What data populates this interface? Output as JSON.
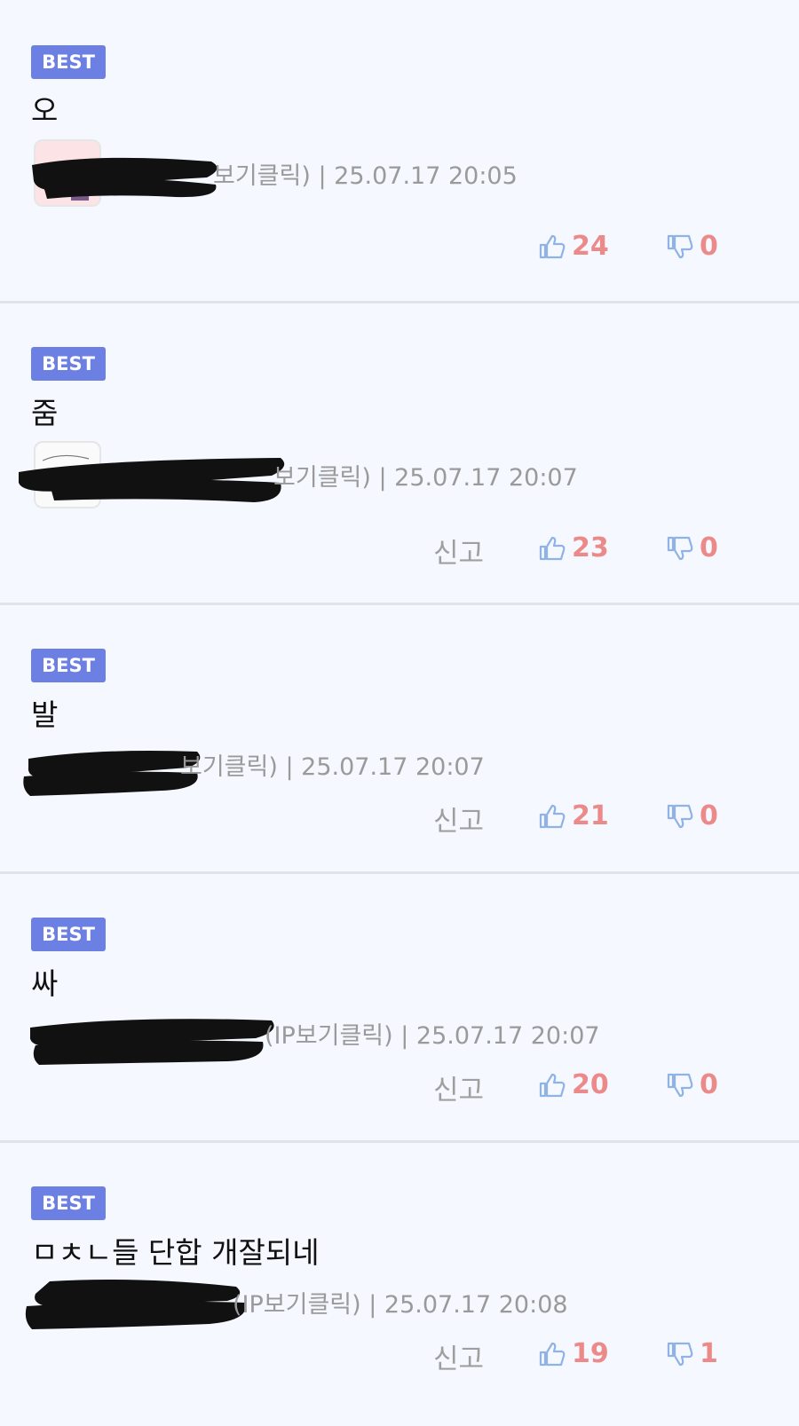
{
  "comments": [
    {
      "badge": "BEST",
      "text": "오",
      "meta_visible": "보기클릭) | 25.07.17 20:05",
      "report": "",
      "likes": "24",
      "dislikes": "0"
    },
    {
      "badge": "BEST",
      "text": "줌",
      "meta_visible": "보기클릭) | 25.07.17 20:07",
      "report": "신고",
      "likes": "23",
      "dislikes": "0"
    },
    {
      "badge": "BEST",
      "text": "발",
      "meta_visible": "보기클릭) | 25.07.17 20:07",
      "report": "신고",
      "likes": "21",
      "dislikes": "0"
    },
    {
      "badge": "BEST",
      "text": "싸",
      "meta_visible": "(IP보기클릭) | 25.07.17 20:07",
      "report": "신고",
      "likes": "20",
      "dislikes": "0"
    },
    {
      "badge": "BEST",
      "text": "ㅁㅊㄴ들 단합 개잘되네",
      "meta_visible": "(IP보기클릭) | 25.07.17 20:08",
      "report": "신고",
      "likes": "19",
      "dislikes": "1"
    }
  ],
  "icons": {
    "like": "thumbs-up-icon",
    "dislike": "thumbs-down-icon"
  },
  "colors": {
    "badge": "#6c7fe3",
    "count": "#ec8a8a",
    "icon": "#8fb3e6",
    "meta": "#9a9a9a"
  }
}
